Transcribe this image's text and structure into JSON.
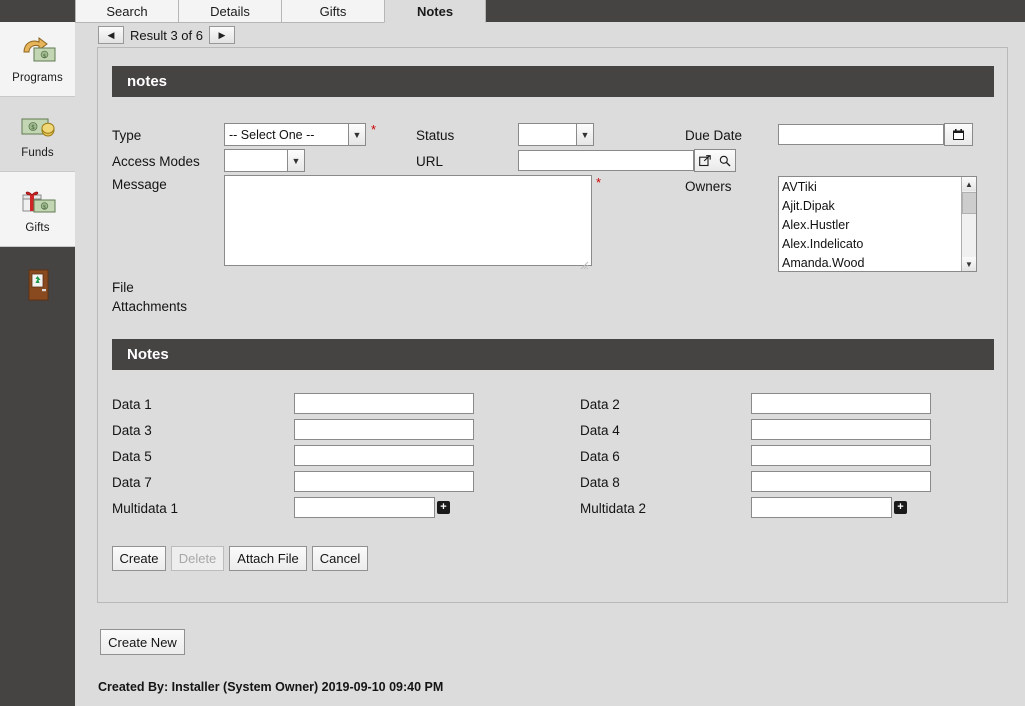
{
  "sidebar": {
    "items": [
      {
        "label": "Programs",
        "icon": "program-money-icon"
      },
      {
        "label": "Funds",
        "icon": "funds-money-icon"
      },
      {
        "label": "Gifts",
        "icon": "gift-money-icon"
      },
      {
        "label": "",
        "icon": "exit-door-icon"
      }
    ]
  },
  "tabs": [
    {
      "label": "Search",
      "active": false
    },
    {
      "label": "Details",
      "active": false
    },
    {
      "label": "Gifts",
      "active": false
    },
    {
      "label": "Notes",
      "active": true
    }
  ],
  "result_nav": {
    "prev_icon": "◀",
    "next_icon": "▶",
    "text": "Result 3 of 6"
  },
  "section_headers": {
    "top": "notes",
    "bottom": "Notes"
  },
  "form": {
    "type": {
      "label": "Type",
      "value": "-- Select One --",
      "required": "*"
    },
    "status": {
      "label": "Status",
      "value": ""
    },
    "due_date": {
      "label": "Due Date",
      "value": "",
      "icon": "calendar-icon"
    },
    "access_modes": {
      "label": "Access Modes",
      "value": ""
    },
    "url": {
      "label": "URL",
      "value": "",
      "open_icon": "external-link-icon",
      "search_icon": "search-icon"
    },
    "message": {
      "label": "Message",
      "value": "",
      "required": "*"
    },
    "owners": {
      "label": "Owners",
      "options": [
        "AVTiki",
        "Ajit.Dipak",
        "Alex.Hustler",
        "Alex.Indelicato",
        "Amanda.Wood"
      ]
    },
    "file_attachments": {
      "label_line1": "File",
      "label_line2": "Attachments"
    }
  },
  "notes_fields": {
    "left": [
      {
        "label": "Data 1",
        "value": ""
      },
      {
        "label": "Data 3",
        "value": ""
      },
      {
        "label": "Data 5",
        "value": ""
      },
      {
        "label": "Data 7",
        "value": ""
      },
      {
        "label": "Multidata 1",
        "value": "",
        "add_icon": "plus-icon"
      }
    ],
    "right": [
      {
        "label": "Data 2",
        "value": ""
      },
      {
        "label": "Data 4",
        "value": ""
      },
      {
        "label": "Data 6",
        "value": ""
      },
      {
        "label": "Data 8",
        "value": ""
      },
      {
        "label": "Multidata 2",
        "value": "",
        "add_icon": "plus-icon"
      }
    ]
  },
  "action_buttons": [
    {
      "label": "Create",
      "disabled": false
    },
    {
      "label": "Delete",
      "disabled": true
    },
    {
      "label": "Attach File",
      "disabled": false
    },
    {
      "label": "Cancel",
      "disabled": false
    }
  ],
  "create_new_button": {
    "label": "Create New"
  },
  "footer": {
    "text": "Created By: Installer (System Owner) 2019-09-10 09:40 PM"
  },
  "colors": {
    "page_bg": "#dcdcdc",
    "dark_bar": "#454443",
    "required_red": "#cc0000",
    "tab_inactive": "#f4f4f4"
  }
}
